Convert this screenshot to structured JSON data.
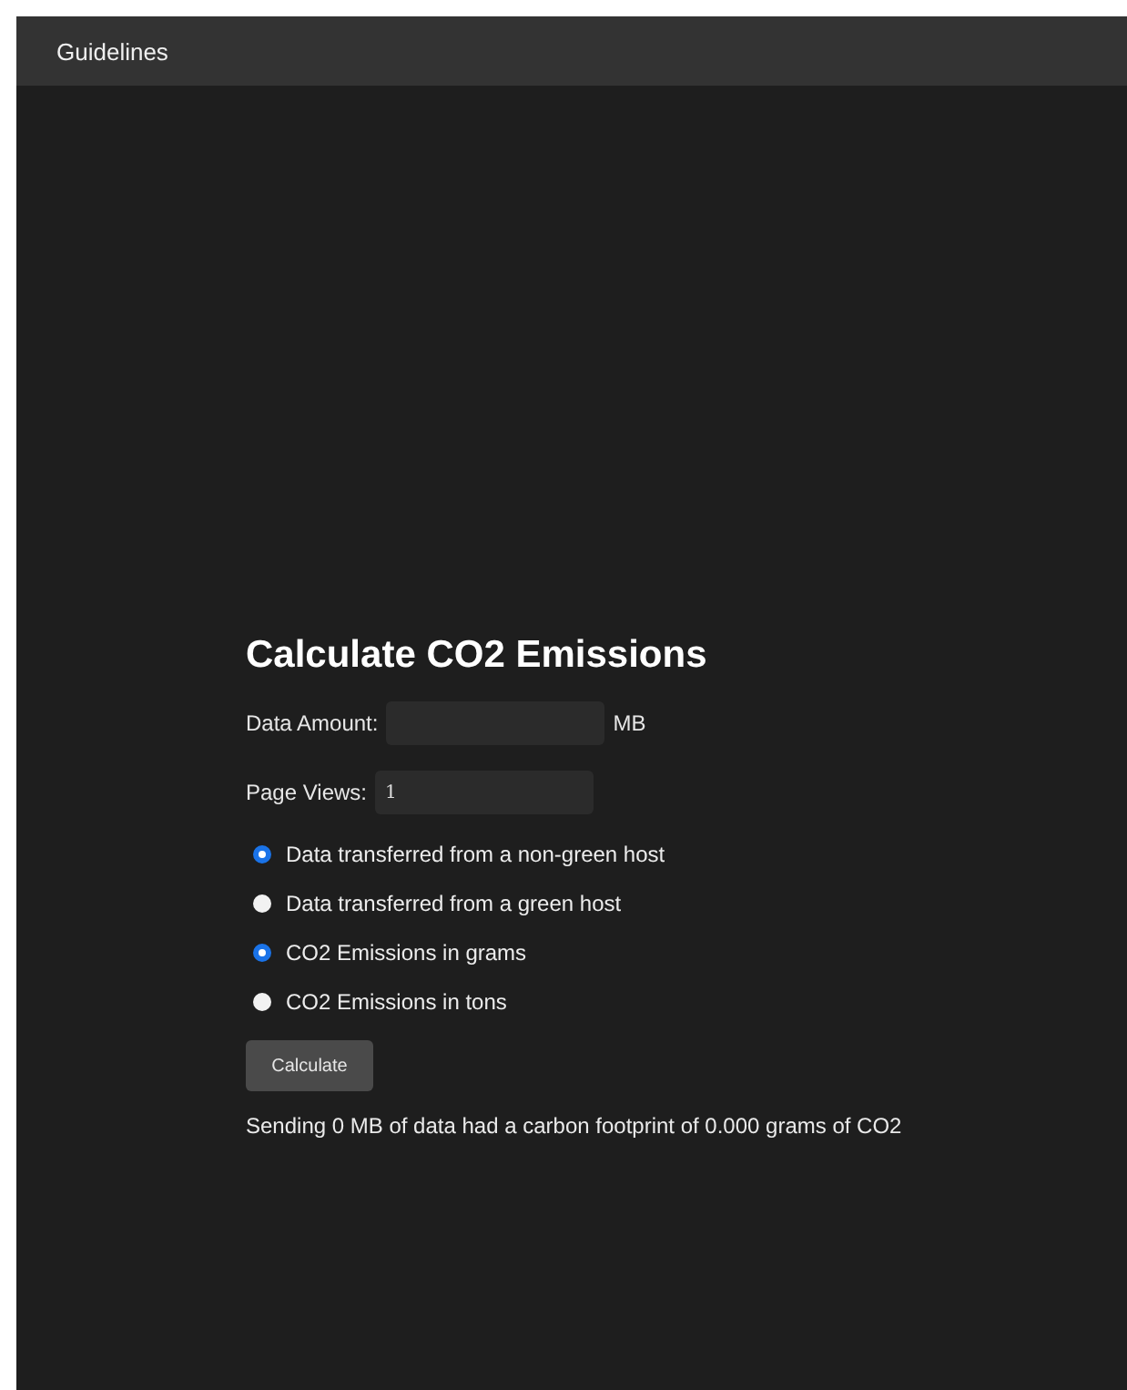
{
  "nav": {
    "title": "Guidelines"
  },
  "form": {
    "heading": "Calculate CO2 Emissions",
    "data_amount": {
      "label": "Data Amount:",
      "unit": "MB"
    },
    "page_views": {
      "label": "Page Views:",
      "value": "1"
    },
    "options": [
      {
        "label": "Data transferred from a non-green host",
        "selected": true
      },
      {
        "label": "Data transferred from a green host",
        "selected": false
      },
      {
        "label": "CO2 Emissions in grams",
        "selected": true
      },
      {
        "label": "CO2 Emissions in tons",
        "selected": false
      }
    ],
    "button": "Calculate",
    "result": "Sending 0 MB of data had a carbon footprint of 0.000 grams of CO2"
  }
}
